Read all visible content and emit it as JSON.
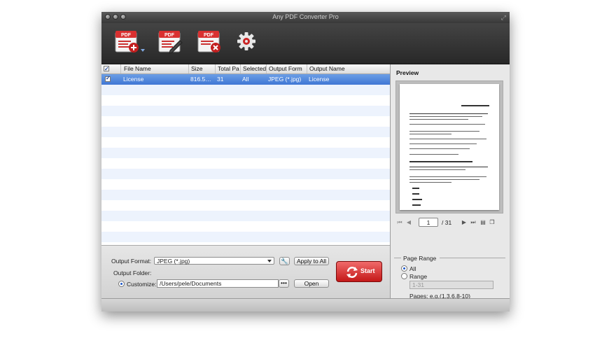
{
  "window": {
    "title": "Any PDF Converter Pro"
  },
  "toolbar": {
    "add_icon_text": "PDF",
    "edit_icon_text": "PDF",
    "remove_icon_text": "PDF"
  },
  "table": {
    "headers": [
      "File Name",
      "Size",
      "Total Pa",
      "Selected",
      "Output Form",
      "Output Name"
    ],
    "rows": [
      {
        "file_name": "License",
        "size": "816.5…",
        "total_pages": "31",
        "selected": "All",
        "output_format": "JPEG (*.jpg)",
        "output_name": "License"
      }
    ]
  },
  "controls": {
    "output_format_label": "Output Format:",
    "output_format_value": "JPEG (*.jpg)",
    "apply_to_all": "Apply to All",
    "output_folder_label": "Output Folder:",
    "customize_label": "Customize:",
    "folder_path": "/Users/pele/Documents",
    "browse_label": "•••",
    "open_label": "Open",
    "start_label": "Start"
  },
  "preview": {
    "title": "Preview",
    "current_page": "1",
    "total_pages": "/ 31",
    "page_range_title": "Page Range",
    "all_label": "All",
    "range_label": "Range",
    "range_placeholder": "1-31",
    "pages_hint": "Pages: e.g.(1,3,6,8-10)"
  },
  "colors": {
    "selection": "#4a7fd8",
    "start_button": "#d62a2a",
    "toolbar_bg": "#333333"
  }
}
